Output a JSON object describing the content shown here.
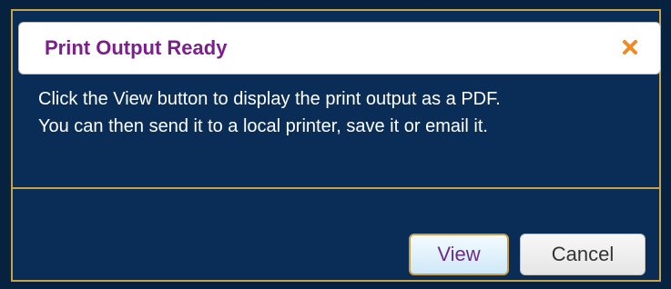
{
  "dialog": {
    "title": "Print Output Ready",
    "message_line1": "Click the View button to display the print output as a PDF.",
    "message_line2": "You can then send it to a local printer, save it or email it.",
    "close_icon": "close-icon",
    "buttons": {
      "view_label": "View",
      "cancel_label": "Cancel"
    }
  },
  "colors": {
    "dialog_background": "#0a2d57",
    "accent_border": "#c8a24a",
    "title_text": "#7b1f8a",
    "close_icon": "#f08a24"
  }
}
